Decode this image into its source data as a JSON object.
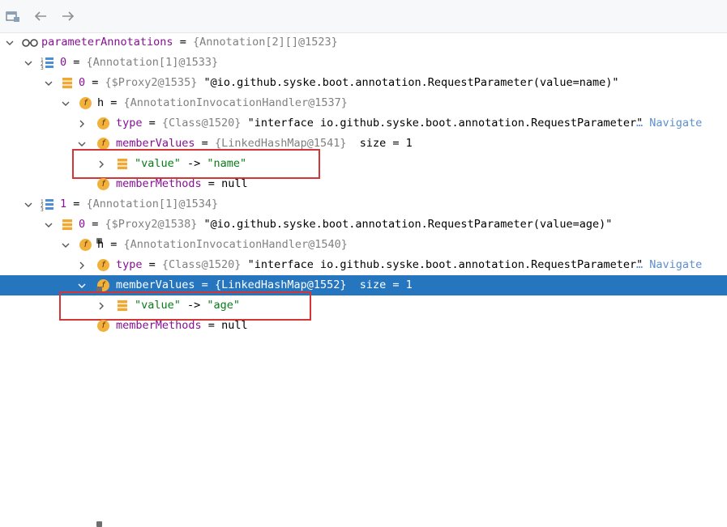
{
  "toolbar": {
    "items": [
      "frame-view-icon",
      "back-arrow-icon",
      "forward-arrow-icon"
    ]
  },
  "tree": {
    "root": {
      "name": "parameterAnnotations",
      "op": " = ",
      "type": "{Annotation[2][]@1523}"
    },
    "p0": {
      "name": "0",
      "op": " = ",
      "type": "{Annotation[1]@1533}"
    },
    "p0_0": {
      "name": "0",
      "op": " = ",
      "type": "{$Proxy2@1535}",
      "value": " \"@io.github.syske.boot.annotation.RequestParameter(value=name)\""
    },
    "p0_h": {
      "name": "h",
      "op": " = ",
      "type": "{AnnotationInvocationHandler@1537}"
    },
    "p0_type": {
      "name": "type",
      "op": " = ",
      "type": "{Class@1520}",
      "value": " \"interface io.github.syske.boot.annotation.RequestParameter\"",
      "navigate": "… Navigate"
    },
    "p0_mv": {
      "name": "memberValues",
      "op": " = ",
      "type": "{LinkedHashMap@1541}",
      "size": "  size = 1"
    },
    "p0_entry": {
      "key": "\"value\"",
      "arrow": " -> ",
      "val": "\"name\""
    },
    "p0_mm": {
      "name": "memberMethods",
      "op": " = ",
      "value": "null"
    },
    "p1": {
      "name": "1",
      "op": " = ",
      "type": "{Annotation[1]@1534}"
    },
    "p1_0": {
      "name": "0",
      "op": " = ",
      "type": "{$Proxy2@1538}",
      "value": " \"@io.github.syske.boot.annotation.RequestParameter(value=age)\""
    },
    "p1_h": {
      "name": "h",
      "op": " = ",
      "type": "{AnnotationInvocationHandler@1540}"
    },
    "p1_type": {
      "name": "type",
      "op": " = ",
      "type": "{Class@1520}",
      "value": " \"interface io.github.syske.boot.annotation.RequestParameter\"",
      "navigate": "… Navigate"
    },
    "p1_mv": {
      "name": "memberValues",
      "op": " = ",
      "type": "{LinkedHashMap@1552}",
      "size": "  size = 1"
    },
    "p1_entry": {
      "key": "\"value\"",
      "arrow": " -> ",
      "val": "\"age\""
    },
    "p1_mm": {
      "name": "memberMethods",
      "op": " = ",
      "value": "null"
    }
  },
  "colors": {
    "selection": "#2675bf",
    "highlight_box": "#d53535",
    "field_icon": "#f2b13c",
    "string": "#067d17",
    "field_name": "#871094"
  }
}
